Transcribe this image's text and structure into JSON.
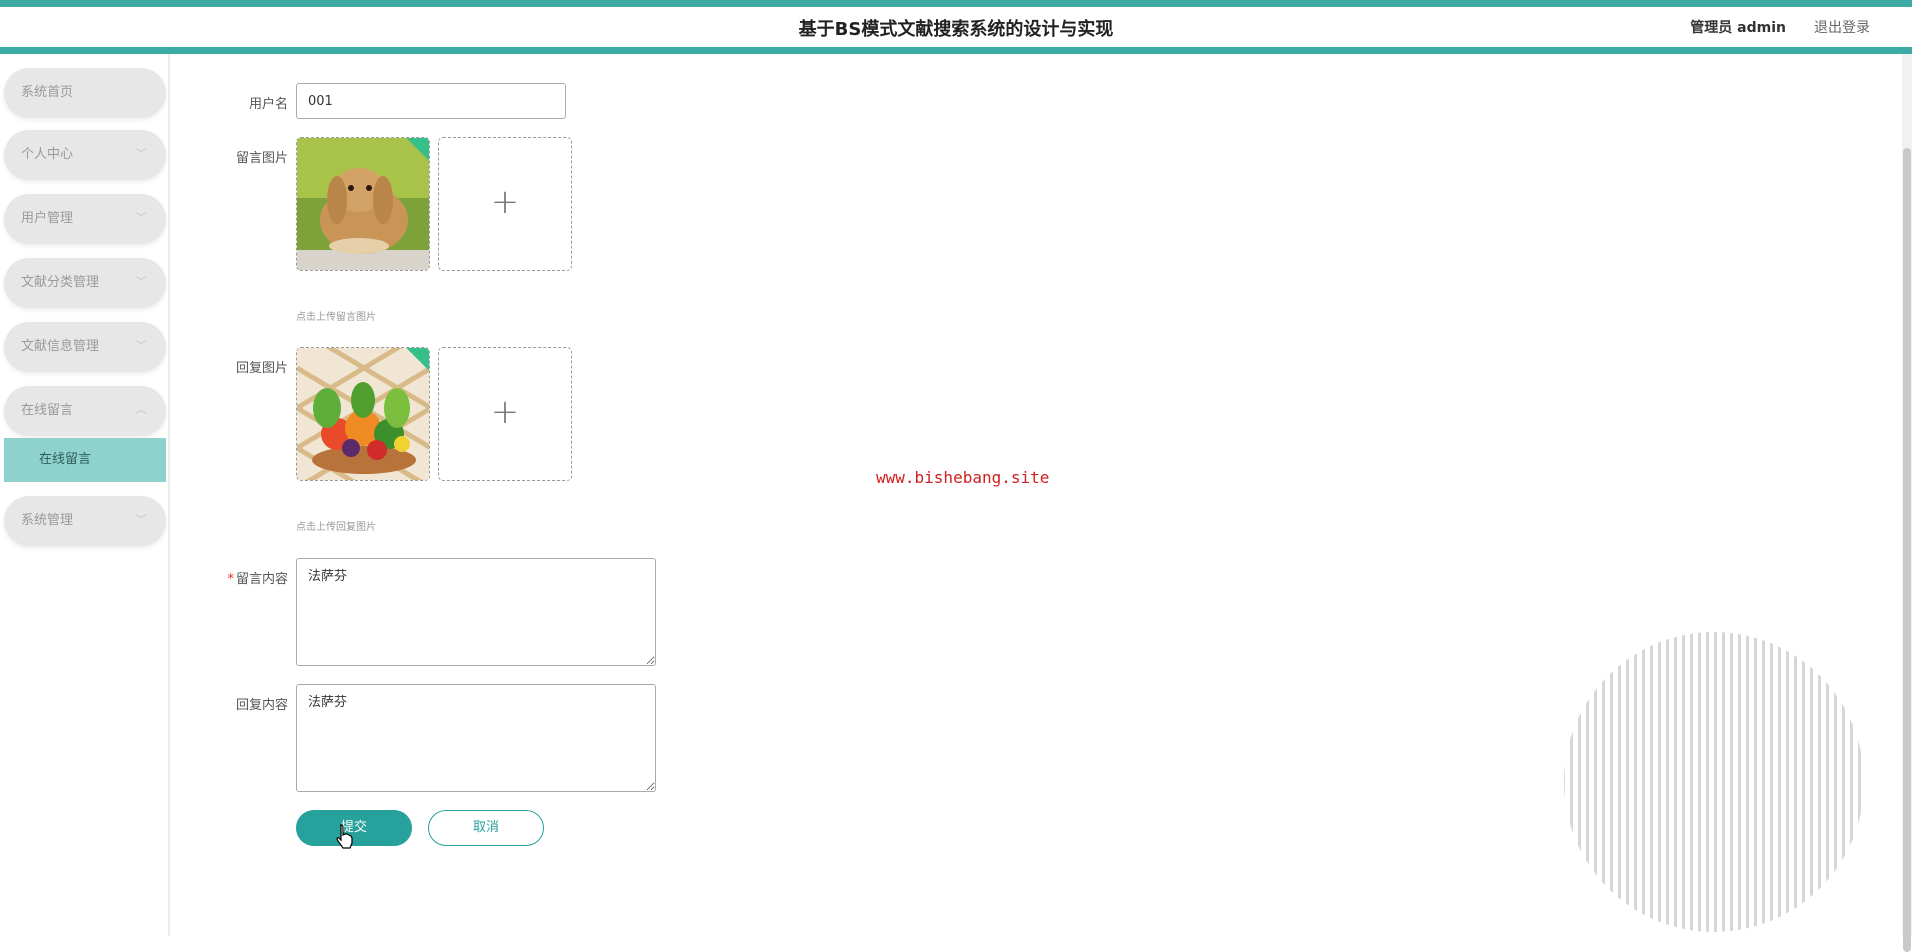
{
  "header": {
    "title": "基于BS模式文献搜索系统的设计与实现",
    "user_label": "管理员 admin",
    "logout_label": "退出登录"
  },
  "sidebar": {
    "items": [
      {
        "label": "系统首页"
      },
      {
        "label": "个人中心"
      },
      {
        "label": "用户管理"
      },
      {
        "label": "文献分类管理"
      },
      {
        "label": "文献信息管理"
      },
      {
        "label": "在线留言"
      },
      {
        "label": "系统管理"
      }
    ],
    "active_sub": "在线留言"
  },
  "form": {
    "username_label": "用户名",
    "username_value": "001",
    "message_image_label": "留言图片",
    "message_image_tip": "点击上传留言图片",
    "reply_image_label": "回复图片",
    "reply_image_tip": "点击上传回复图片",
    "add_symbol": "+",
    "required_mark": "*",
    "message_content_label": "留言内容",
    "message_content_value": "法萨芬",
    "reply_content_label": "回复内容",
    "reply_content_value": "法萨芬",
    "submit_label": "提交",
    "cancel_label": "取消"
  },
  "watermark": "www.bishebang.site",
  "colors": {
    "accent": "#3eaaa5",
    "button": "#27a19c",
    "active_menu": "#8fd2cd",
    "required": "#e03030"
  }
}
